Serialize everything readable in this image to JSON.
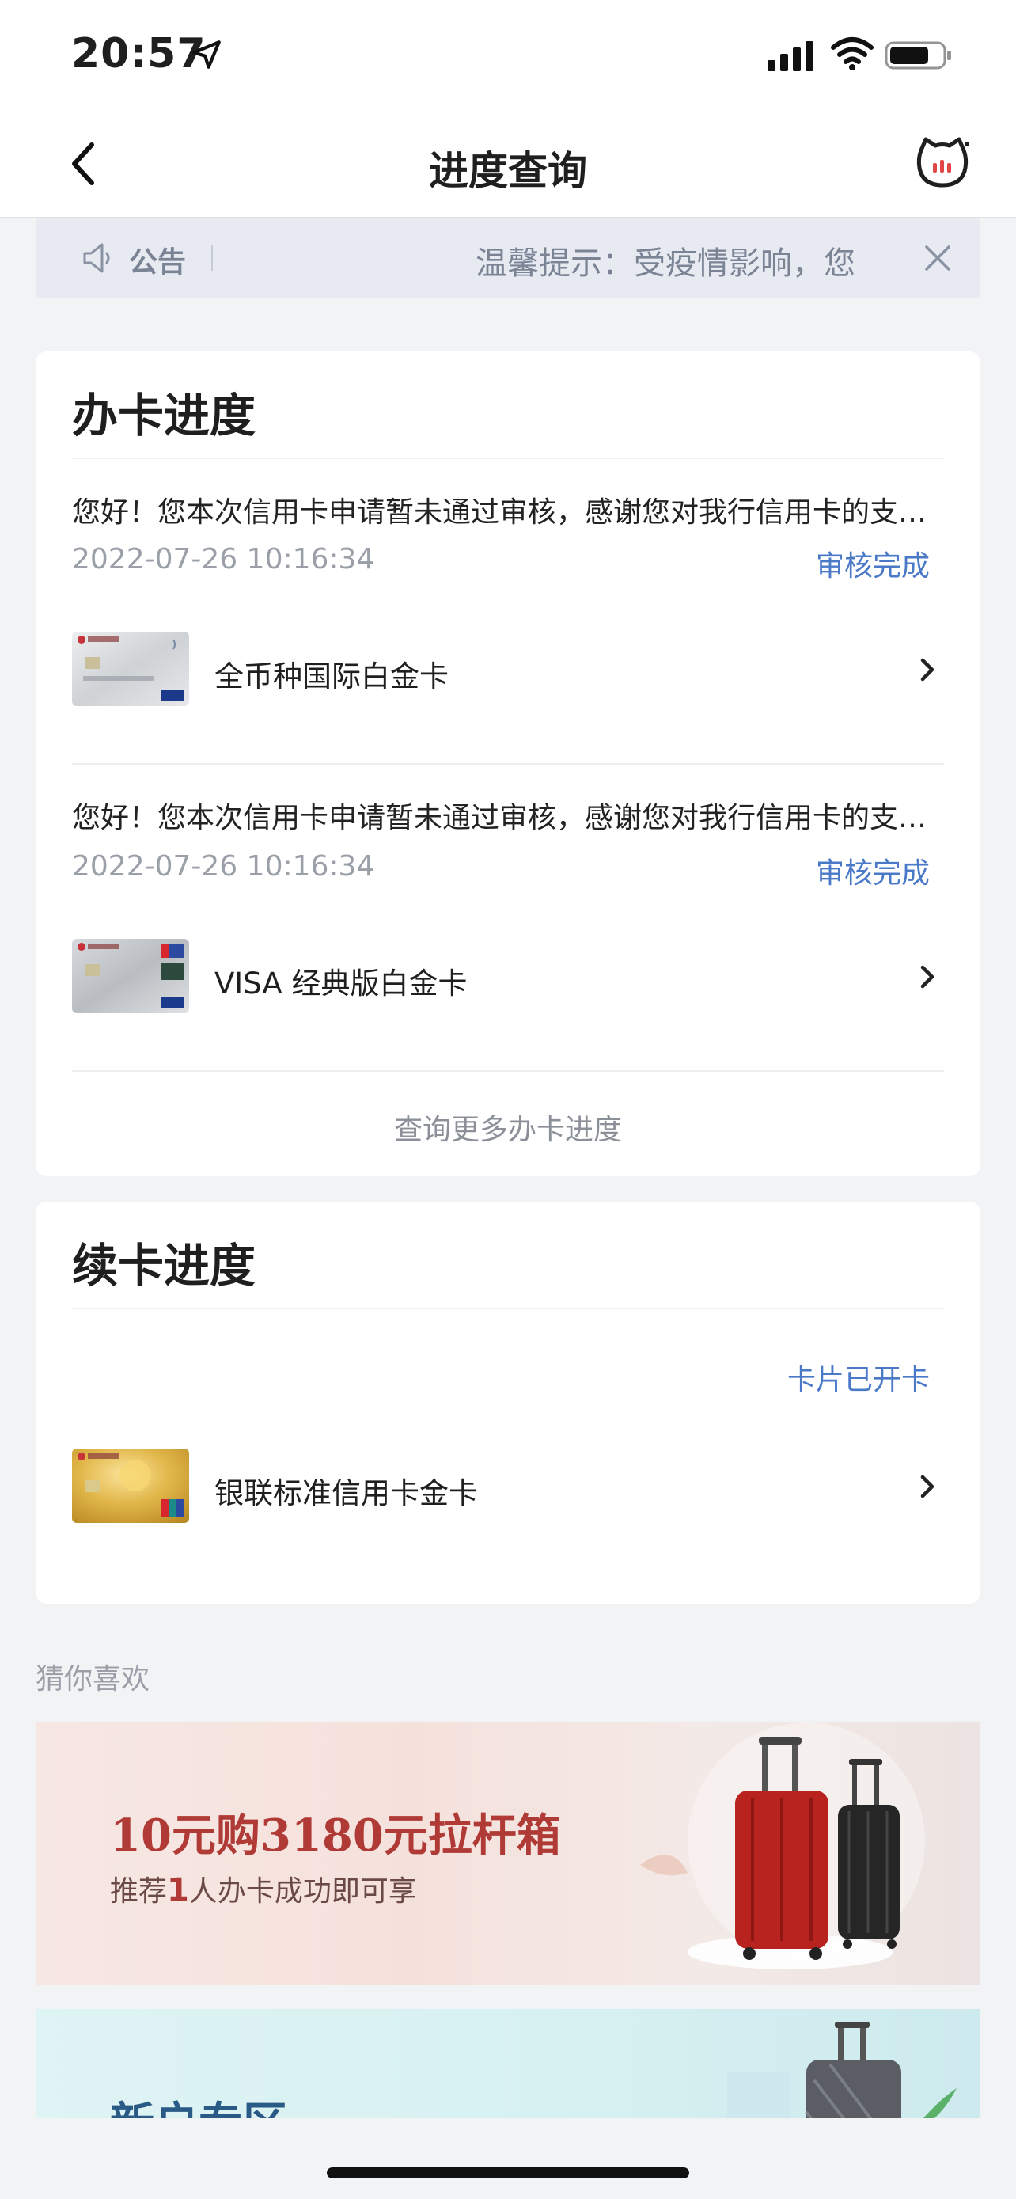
{
  "status_bar": {
    "time": "20:57"
  },
  "nav": {
    "title": "进度查询"
  },
  "notice": {
    "label": "公告",
    "text": "温馨提示：受疫情影响，您"
  },
  "apply_section": {
    "title": "办卡进度",
    "items": [
      {
        "message": "您好！您本次信用卡申请暂未通过审核，感谢您对我行信用卡的支持！",
        "timestamp": "2022-07-26 10:16:34",
        "status": "审核完成",
        "card_name": "全币种国际白金卡"
      },
      {
        "message": "您好！您本次信用卡申请暂未通过审核，感谢您对我行信用卡的支持！",
        "timestamp": "2022-07-26 10:16:34",
        "status": "审核完成",
        "card_name": "VISA 经典版白金卡"
      }
    ],
    "more_link": "查询更多办卡进度"
  },
  "renew_section": {
    "title": "续卡进度",
    "status": "卡片已开卡",
    "card_name": "银联标准信用卡金卡"
  },
  "recommend": {
    "heading": "猜你喜欢",
    "banner1": {
      "title": "10元购3180元拉杆箱",
      "sub_before": "推荐",
      "sub_highlight": "1",
      "sub_after": "人办卡成功即可享"
    },
    "banner2": {
      "title": "新户专区"
    }
  },
  "colors": {
    "accent_blue": "#4a79c8",
    "notice_bg": "#e7ebf1",
    "banner_red": "#b03a35"
  }
}
